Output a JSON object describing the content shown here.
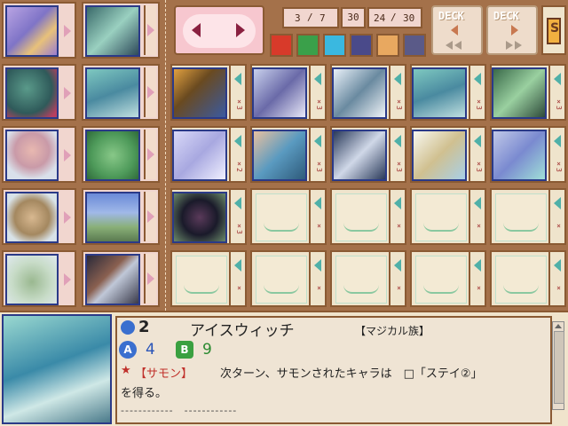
{
  "hand_counts": {
    "a": "3",
    "a_max": "7",
    "b": "30",
    "c": "24",
    "c_max": "30"
  },
  "deck_labels": [
    "DECK",
    "DECK"
  ],
  "side_tab": "S",
  "board": {
    "row1_counts": [
      "3",
      "3",
      "3",
      "3",
      "3"
    ],
    "row2_counts": [
      "2",
      "3",
      "3",
      "3",
      "3"
    ],
    "row3_counts": [
      "3",
      "",
      "",
      "",
      ""
    ]
  },
  "detail": {
    "cost": "2",
    "name": "アイスウィッチ",
    "tribe": "【マジカル族】",
    "stat_a_label": "A",
    "stat_a_value": "4",
    "stat_b_label": "B",
    "stat_b_value": "9",
    "ability_tag": "【サモン】",
    "ability_text": "次ターン、サモンされたキャラは　□「ステイ②」",
    "ability_text2": "を得る。",
    "divider_text": "------------　------------"
  },
  "colors": {
    "frame": "#8a5a33",
    "slot_bg": "#efe4cc",
    "card_border": "#2b3a88",
    "accent_red": "#c0302a",
    "stat_a": "#3a6fcf",
    "stat_b": "#3aa040"
  }
}
